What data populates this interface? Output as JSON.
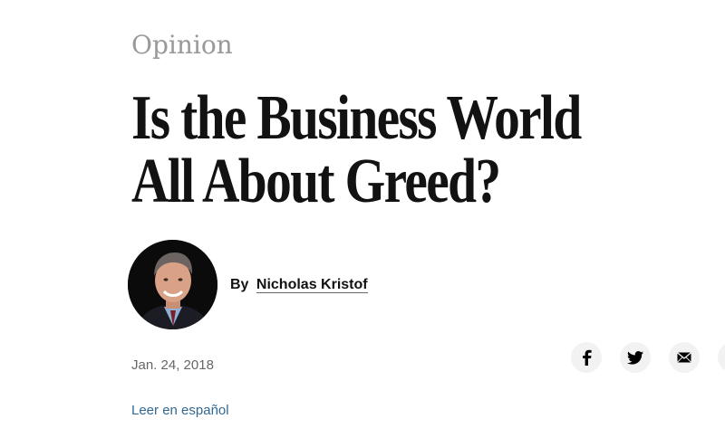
{
  "article": {
    "section": "Opinion",
    "headline_line1": "Is the Business World",
    "headline_line2": "All About Greed?",
    "byline_prefix": "By",
    "author": "Nicholas Kristof",
    "date": "Jan. 24, 2018",
    "translation_link": "Leer en español"
  },
  "share": {
    "icons": [
      "facebook-icon",
      "twitter-icon",
      "email-icon",
      "more-icon"
    ]
  },
  "colors": {
    "headline": "#121212",
    "section": "#999999",
    "link": "#326891",
    "share_bg": "#f2f2f2"
  }
}
